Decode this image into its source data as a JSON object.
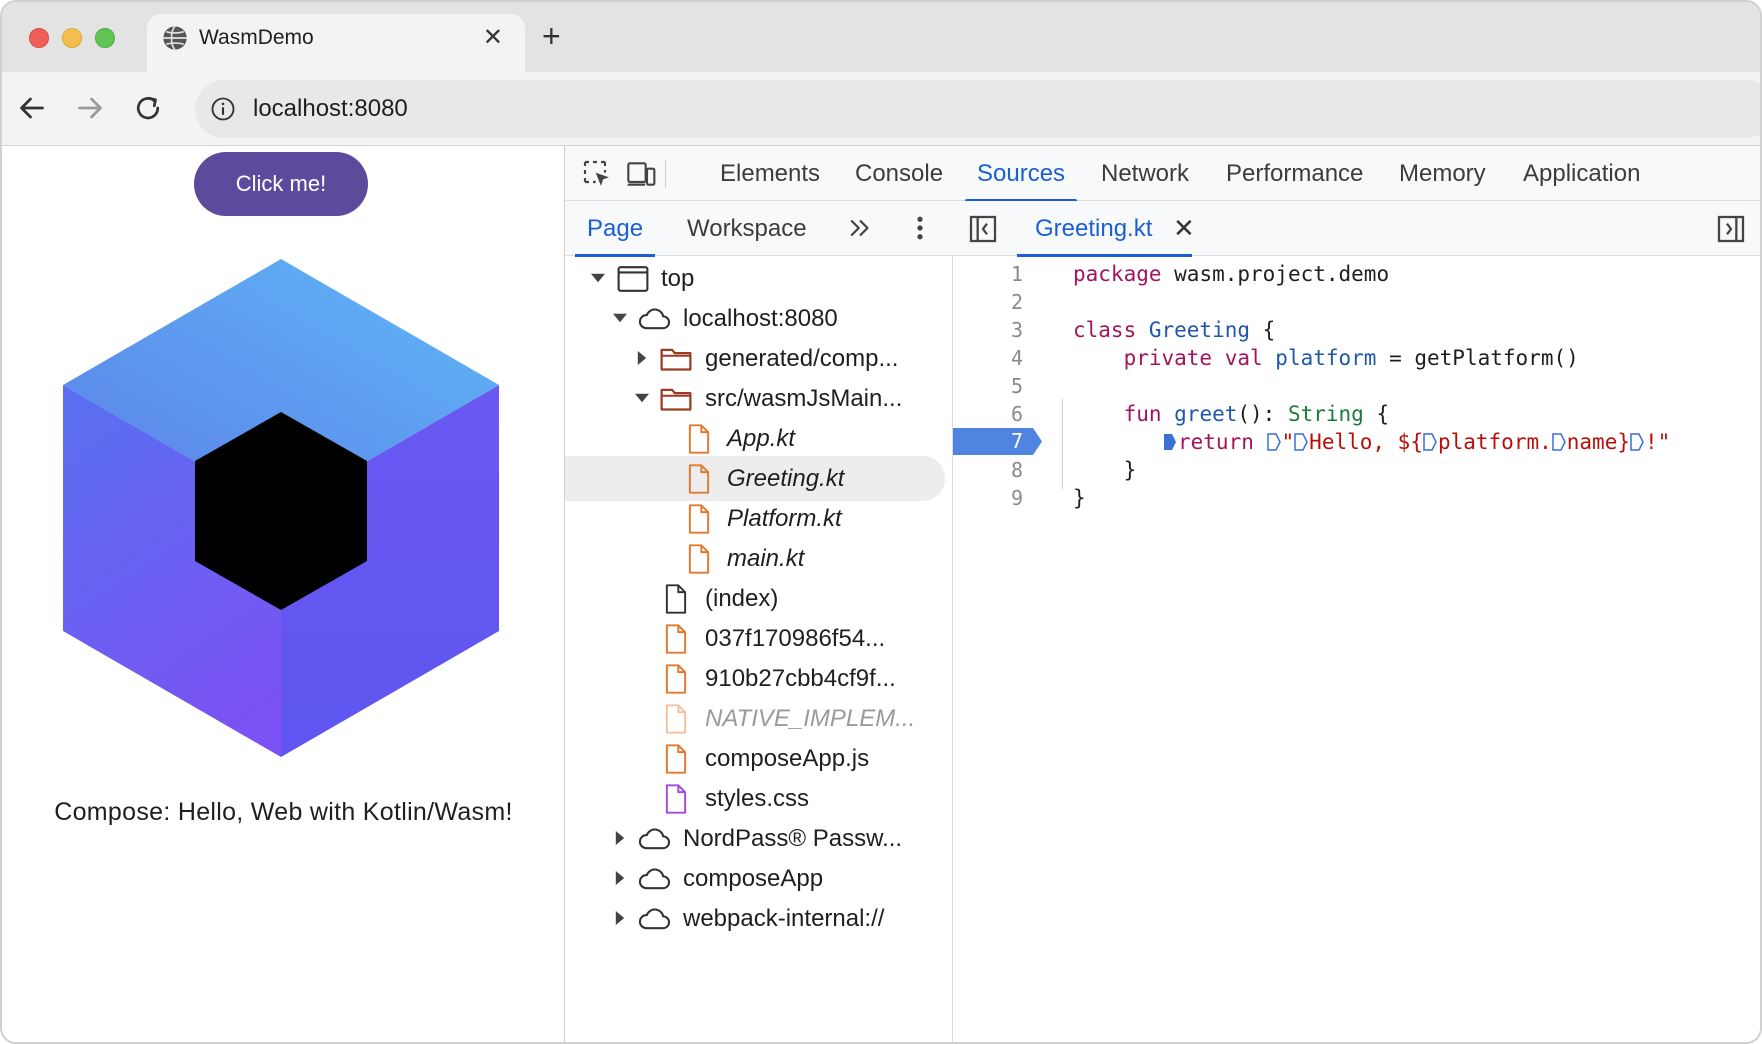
{
  "browser": {
    "tab_title": "WasmDemo",
    "tab_close": "✕",
    "new_tab": "+",
    "url": "localhost:8080"
  },
  "page": {
    "button_label": "Click me!",
    "greeting": "Compose: Hello, Web with Kotlin/Wasm!"
  },
  "devtools": {
    "tabs": [
      "Elements",
      "Console",
      "Sources",
      "Network",
      "Performance",
      "Memory",
      "Application"
    ],
    "active_tab": "Sources",
    "navigator": {
      "tabs": [
        "Page",
        "Workspace"
      ],
      "active_tab": "Page",
      "tree": [
        {
          "label": "top",
          "icon": "frame-icon",
          "expanded": true
        },
        {
          "label": "localhost:8080",
          "icon": "cloud-icon",
          "expanded": true
        },
        {
          "label": "generated/comp...",
          "icon": "folder-icon",
          "expanded": false
        },
        {
          "label": "src/wasmJsMain...",
          "icon": "folder-icon",
          "expanded": true
        },
        {
          "label": "App.kt",
          "icon": "file-icon",
          "color": "#e07a2f"
        },
        {
          "label": "Greeting.kt",
          "icon": "file-icon",
          "color": "#e07a2f",
          "selected": true
        },
        {
          "label": "Platform.kt",
          "icon": "file-icon",
          "color": "#e07a2f"
        },
        {
          "label": "main.kt",
          "icon": "file-icon",
          "color": "#e07a2f"
        },
        {
          "label": "(index)",
          "icon": "file-icon",
          "color": "#333333"
        },
        {
          "label": "037f170986f54...",
          "icon": "file-icon",
          "color": "#e07a2f"
        },
        {
          "label": "910b27cbb4cf9f...",
          "icon": "file-icon",
          "color": "#e07a2f"
        },
        {
          "label": "NATIVE_IMPLEM...",
          "icon": "file-icon",
          "color": "#f2c2a0"
        },
        {
          "label": "composeApp.js",
          "icon": "file-icon",
          "color": "#e07a2f"
        },
        {
          "label": "styles.css",
          "icon": "file-icon",
          "color": "#a349e0"
        },
        {
          "label": "NordPass® Passw...",
          "icon": "cloud-icon",
          "expanded": false
        },
        {
          "label": "composeApp",
          "icon": "cloud-icon",
          "expanded": false
        },
        {
          "label": "webpack-internal://",
          "icon": "cloud-icon",
          "expanded": false
        }
      ]
    },
    "editor": {
      "file_tab": "Greeting.kt",
      "close": "✕",
      "breakpoint_line": "7",
      "line_numbers": [
        "1",
        "2",
        "3",
        "4",
        "5",
        "6",
        "7",
        "8",
        "9"
      ],
      "code": {
        "l1_kw": "package",
        "l1_rest": " wasm.project.demo",
        "l3_kw": "class",
        "l3_type": " Greeting",
        "l3_rest": " {",
        "l4_kw": "    private val",
        "l4_name": " platform",
        "l4_rest": " = getPlatform()",
        "l6_kw": "    fun",
        "l6_fn": " greet",
        "l6_mid": "(): ",
        "l6_type": "String",
        "l6_rest": " {",
        "l7_kw": "return ",
        "l7_q": "\"",
        "l7_str1": "Hello, ${",
        "l7_str2": "platform.",
        "l7_str3": "name}",
        "l7_str4": "!\"",
        "l8": "    }",
        "l9": "}"
      }
    }
  },
  "colors": {
    "accent": "#1b5fd2",
    "button": "#5c4b9c",
    "breakpoint": "#4f84e0"
  }
}
